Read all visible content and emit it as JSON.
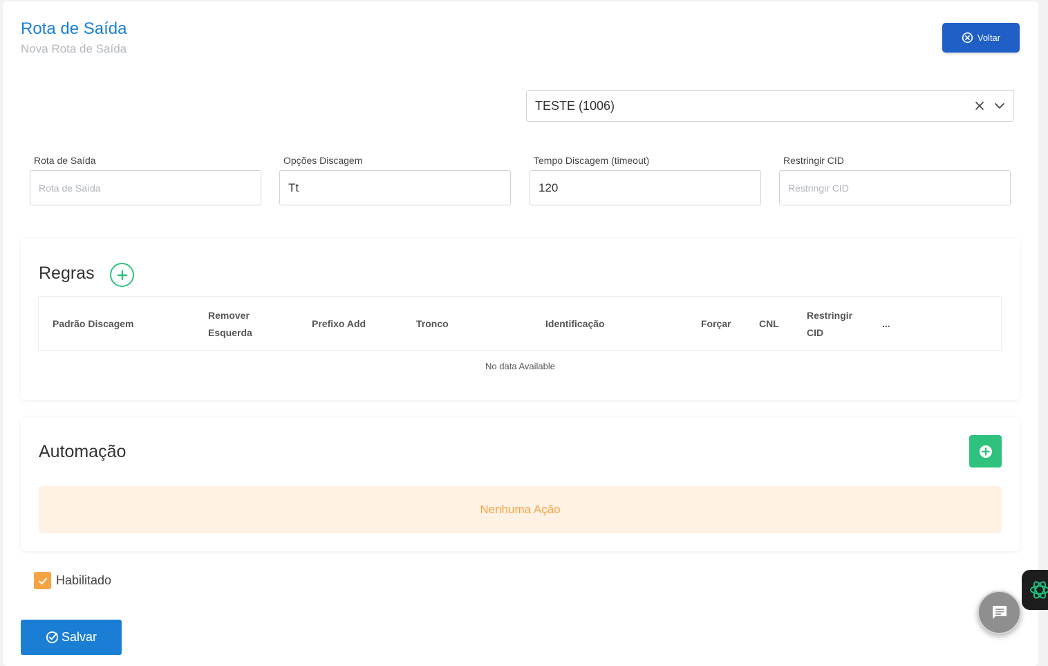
{
  "header": {
    "title": "Rota de Saída",
    "subtitle": "Nova Rota de Saída",
    "back_label": "Voltar"
  },
  "selector": {
    "value": "TESTE (1006)"
  },
  "fields": {
    "route": {
      "label": "Rota de Saída",
      "placeholder": "Rota de Saída",
      "value": ""
    },
    "dial_options": {
      "label": "Opções Discagem",
      "placeholder": "",
      "value": "Tt"
    },
    "dial_timeout": {
      "label": "Tempo Discagem (timeout)",
      "placeholder": "",
      "value": "120"
    },
    "restrict_cid": {
      "label": "Restringir CID",
      "placeholder": "Restringir CID",
      "value": ""
    }
  },
  "rules": {
    "title": "Regras",
    "columns": {
      "dial_pattern": "Padrão Discagem",
      "remove_left_1": "Remover",
      "remove_left_2": "Esquerda",
      "prefix_add": "Prefixo Add",
      "trunk": "Tronco",
      "identification": "Identificação",
      "force": "Forçar",
      "cnl": "CNL",
      "restrict_cid_1": "Restringir",
      "restrict_cid_2": "CID",
      "more": "..."
    },
    "empty_text": "No data Available"
  },
  "automation": {
    "title": "Automação",
    "empty_text": "Nenhuma Ação"
  },
  "enabled": {
    "label": "Habilitado",
    "checked": true
  },
  "save_label": "Salvar",
  "colors": {
    "primary": "#1a7fd4",
    "back_button": "#1f5fc6",
    "success": "#2ec27e",
    "warning": "#f6a443",
    "warning_bg": "#fff1e4"
  }
}
